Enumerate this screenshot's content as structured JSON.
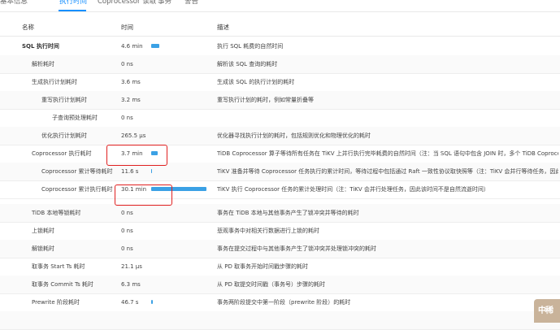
{
  "tabs": [
    {
      "label": "基本信息"
    },
    {
      "label": "执行时间"
    },
    {
      "label": "Coprocessor 读取"
    },
    {
      "label": "事务"
    },
    {
      "label": "警告"
    }
  ],
  "table": {
    "columns": {
      "name": "名称",
      "time": "时间",
      "desc": "描述"
    },
    "rows": [
      {
        "name": "SQL 执行时间",
        "time": "4.6 min",
        "bar_fraction": 0.15,
        "desc": "执行 SQL 耗费的自然时间"
      },
      {
        "name": "解析耗时",
        "time": "0 ns",
        "bar_fraction": 0,
        "desc": "解析该 SQL 查询的耗时"
      },
      {
        "name": "生成执行计划耗时",
        "time": "3.6 ms",
        "bar_fraction": 0,
        "desc": "生成该 SQL 的执行计划的耗时"
      },
      {
        "name": "重写执行计划耗时",
        "time": "3.2 ms",
        "bar_fraction": 0,
        "desc": "重写执行计划的耗时，例如常量折叠等"
      },
      {
        "name": "子查询预处理耗时",
        "time": "0 ns",
        "bar_fraction": 0,
        "desc": ""
      },
      {
        "name": "优化执行计划耗时",
        "time": "265.5 µs",
        "bar_fraction": 0,
        "desc": "优化器寻找执行计划的耗时，包括规则优化和物理优化的耗时"
      },
      {
        "name": "Coprocessor 执行耗时",
        "time": "3.7 min",
        "bar_fraction": 0.12,
        "desc": "TiDB Coprocessor 算子等待所有任务在 TiKV 上并行执行完毕耗费的自然时间（注：当 SQL 语句中包含 JOIN 时，多个 TiDB Coprocessor ..."
      },
      {
        "name": "Coprocessor 累计等待耗时",
        "time": "11.6 s",
        "bar_fraction": 0.01,
        "desc": "TiKV 准备并等待 Coprocessor 任务执行的累计时间，等待过程中包括通过 Raft 一致性协议取快照等（注：TiKV 会并行等待任务，因此该..."
      },
      {
        "name": "Coprocessor 累计执行耗时",
        "time": "30.1 min",
        "bar_fraction": 1.0,
        "desc": "TiKV 执行 Coprocessor 任务的累计处理时间（注：TiKV 会并行处理任务，因此该时间不是自然流逝时间）"
      },
      {
        "name": "TiDB 本地等锁耗时",
        "time": "0 ns",
        "bar_fraction": 0,
        "desc": "事务在 TiDB 本地与其他事务产生了锁冲突并等待的耗时"
      },
      {
        "name": "上锁耗时",
        "time": "0 ns",
        "bar_fraction": 0,
        "desc": "悲观事务中对相关行数据进行上锁的耗时"
      },
      {
        "name": "解锁耗时",
        "time": "0 ns",
        "bar_fraction": 0,
        "desc": "事务在提交过程中与其他事务产生了锁冲突并处理锁冲突的耗时"
      },
      {
        "name": "取事务 Start Ts 耗时",
        "time": "21.1 µs",
        "bar_fraction": 0,
        "desc": "从 PD 取事务开始时间戳步骤的耗时"
      },
      {
        "name": "取事务 Commit Ts 耗时",
        "time": "6.3 ms",
        "bar_fraction": 0,
        "desc": "从 PD 取提交时间戳（事务号）步骤的耗时"
      },
      {
        "name": "Prewrite 阶段耗时",
        "time": "46.7 s",
        "bar_fraction": 0.03,
        "desc": "事务两阶段提交中第一阶段（prewrite 阶段）的耗时"
      }
    ]
  },
  "watermark": {
    "text": "中稀"
  },
  "colors": {
    "accent": "#1890ff",
    "bar": "#3ba1e5",
    "highlight": "#e02020"
  }
}
